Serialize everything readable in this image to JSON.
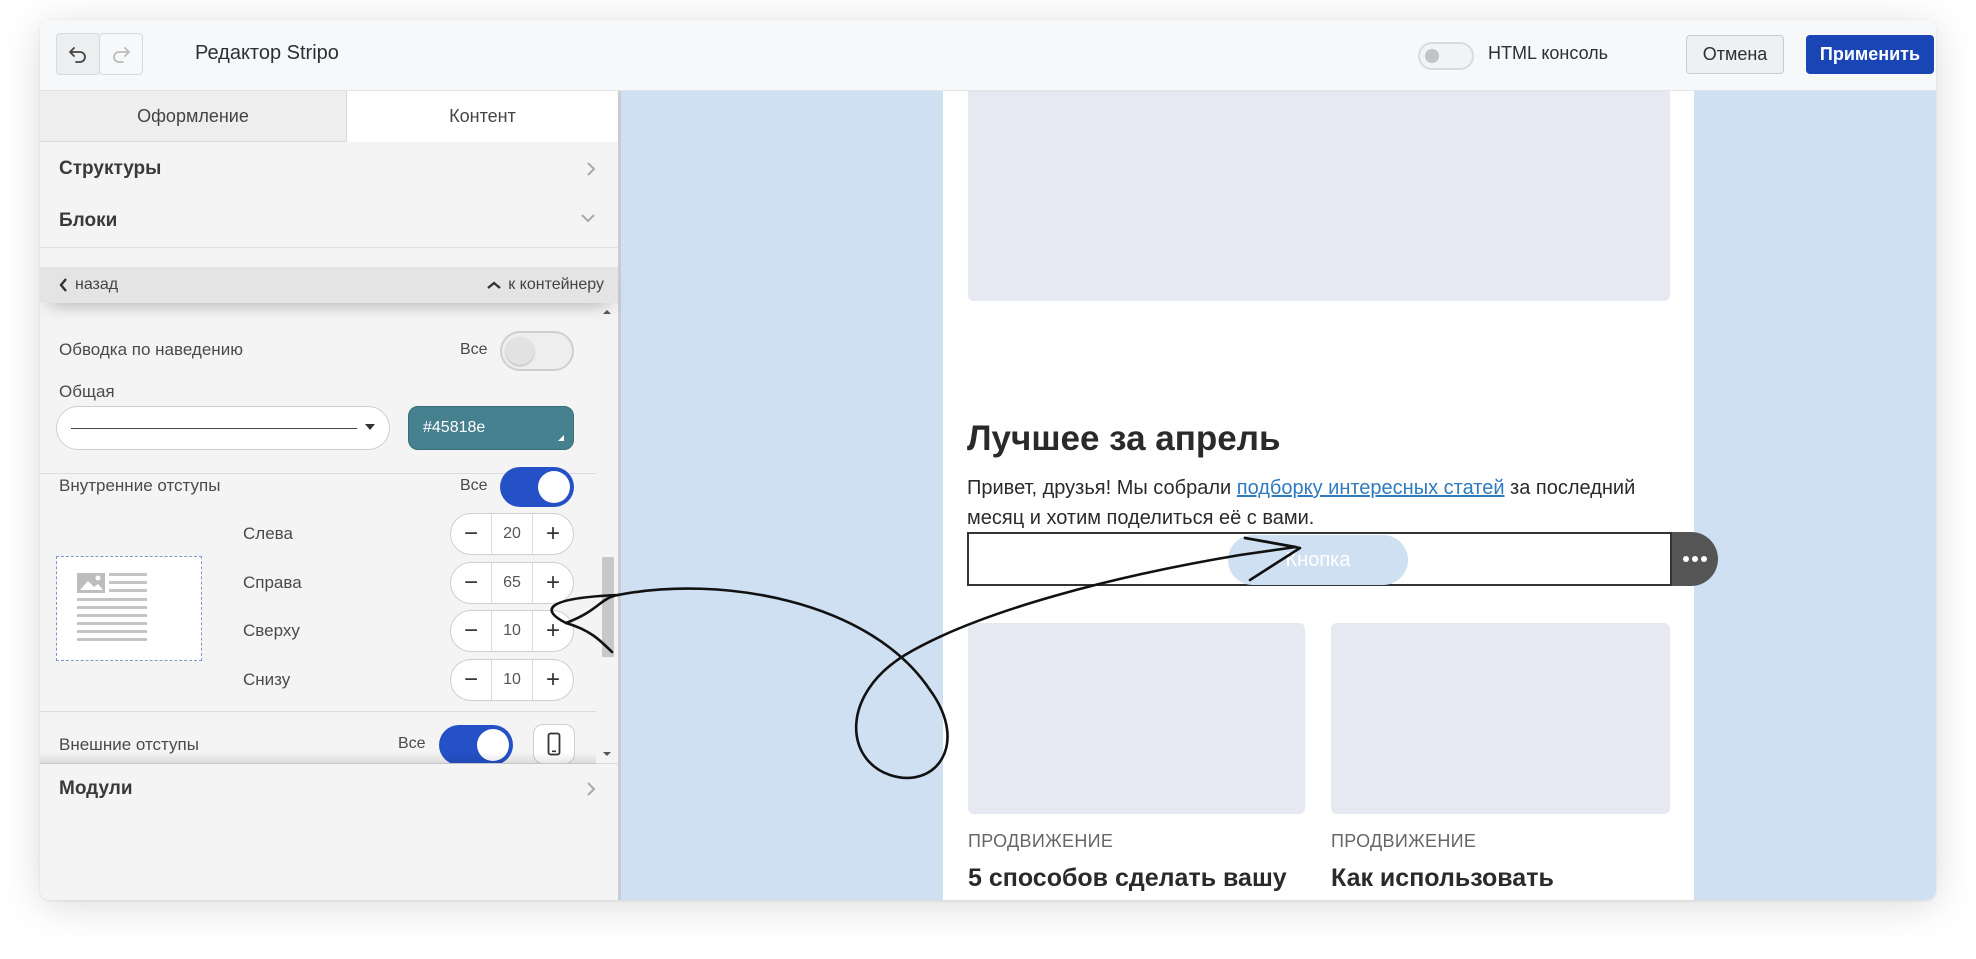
{
  "header": {
    "undo_icon": "undo-icon",
    "redo_icon": "redo-icon",
    "title": "Редактор Stripo",
    "html_console_label": "HTML консоль",
    "cancel_label": "Отмена",
    "apply_label": "Применить",
    "apply_color": "#1a45b5"
  },
  "tabs": [
    "Оформление",
    "Контент"
  ],
  "sections": {
    "structures": "Структуры",
    "blocks": "Блоки",
    "modules": "Модули"
  },
  "nav": {
    "back": "назад",
    "to_container": "к контейнеру"
  },
  "settings": {
    "hover_border": {
      "label": "Обводка по наведению",
      "all": "Все",
      "on": false
    },
    "general": {
      "label": "Общая",
      "color": "#45818e"
    },
    "inner_padding": {
      "label": "Внутренние отступы",
      "all": "Все",
      "on": true,
      "fields": [
        {
          "label": "Слева",
          "value": "20"
        },
        {
          "label": "Справа",
          "value": "65"
        },
        {
          "label": "Сверху",
          "value": "10"
        },
        {
          "label": "Снизу",
          "value": "10"
        }
      ]
    },
    "outer_padding": {
      "label": "Внешние отступы",
      "all": "Все",
      "on": true
    }
  },
  "email": {
    "heading": "Лучшее за апрель",
    "text_before": "Привет, друзья! Мы собрали ",
    "link_text": "подборку интересных статей",
    "text_after": " за последний месяц и хотим поделиться её с вами.",
    "button_label": "Кнопка",
    "cards": [
      {
        "category": "ПРОДВИЖЕНИЕ",
        "title": "5 способов сделать вашу"
      },
      {
        "category": "ПРОДВИЖЕНИЕ",
        "title": "Как использовать"
      }
    ]
  },
  "colors": {
    "canvas_bg": "#cfe0f2",
    "toggle_on": "#2451c6",
    "link": "#2f7bbf"
  }
}
